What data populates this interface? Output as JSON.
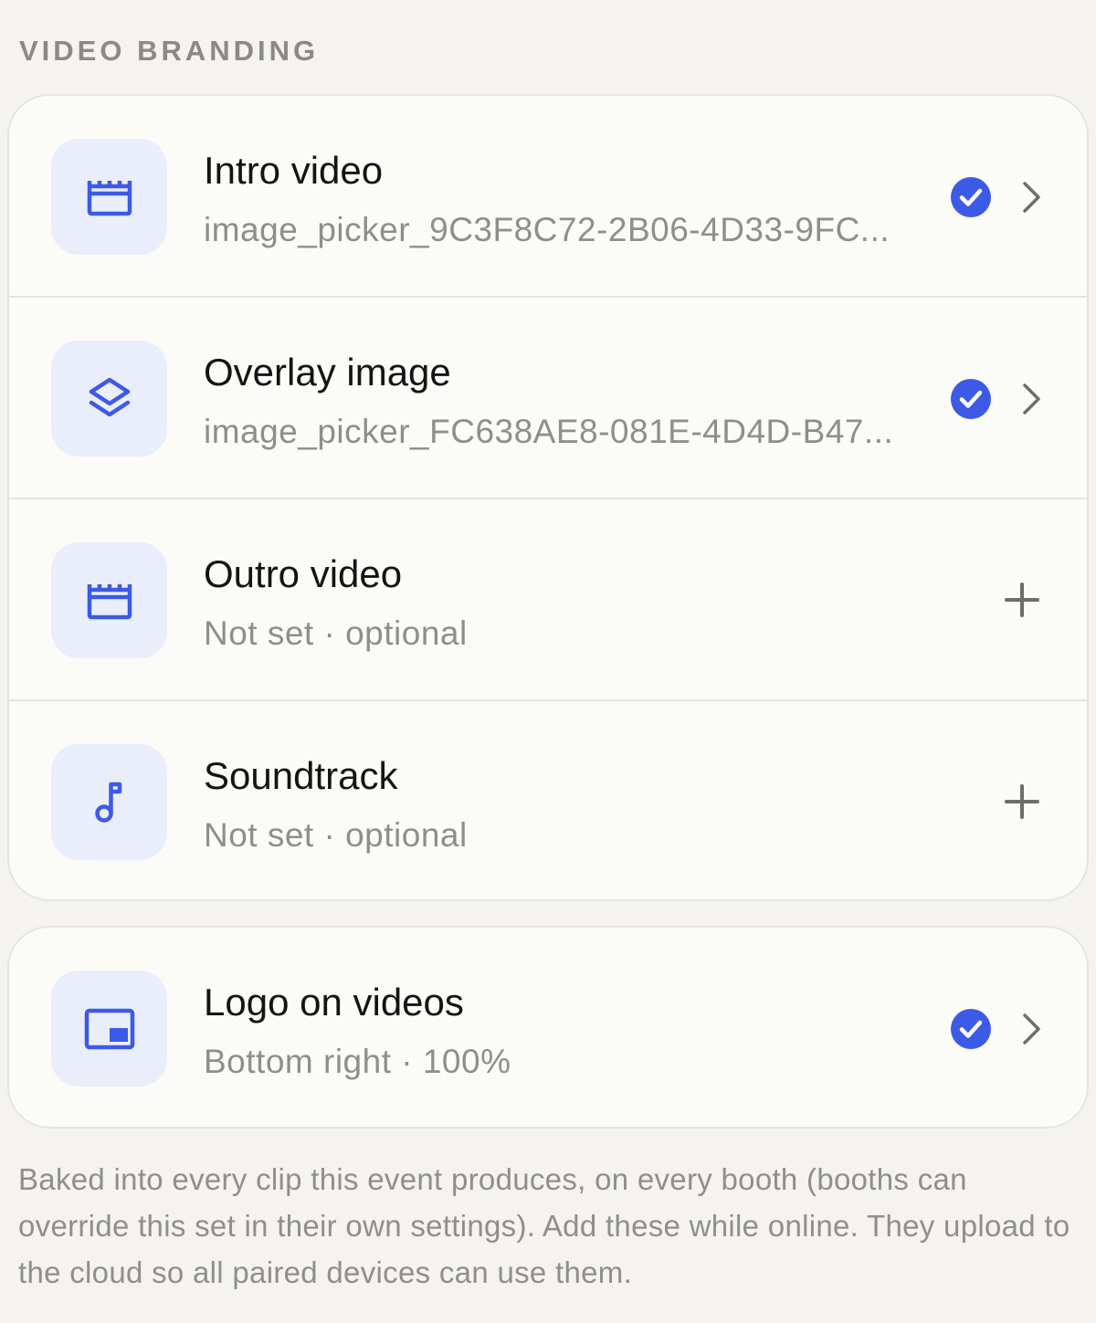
{
  "section": {
    "title": "VIDEO BRANDING"
  },
  "items": [
    {
      "title": "Intro video",
      "subtitle": "image_picker_9C3F8C72-2B06-4D33-9FC...",
      "icon": "clapperboard-icon",
      "status": "set"
    },
    {
      "title": "Overlay image",
      "subtitle": "image_picker_FC638AE8-081E-4D4D-B47...",
      "icon": "layers-icon",
      "status": "set"
    },
    {
      "title": "Outro video",
      "subtitle": "Not set · optional",
      "icon": "clapperboard-icon",
      "status": "empty"
    },
    {
      "title": "Soundtrack",
      "subtitle": "Not set · optional",
      "icon": "music-note-icon",
      "status": "empty"
    }
  ],
  "logo": {
    "title": "Logo on videos",
    "subtitle": "Bottom right · 100%",
    "icon": "picture-in-picture-icon",
    "status": "set"
  },
  "footnote": "Baked into every clip this event produces, on every booth (booths can override this set in their own settings). Add these while online. They upload to the cloud so all paired devices can use them.",
  "colors": {
    "accent": "#3d5ae6",
    "icon_bg": "#eaeefb",
    "card_bg": "#fbfbf8",
    "page_bg": "#f4f3ef",
    "muted_text": "#8f8e8a"
  }
}
